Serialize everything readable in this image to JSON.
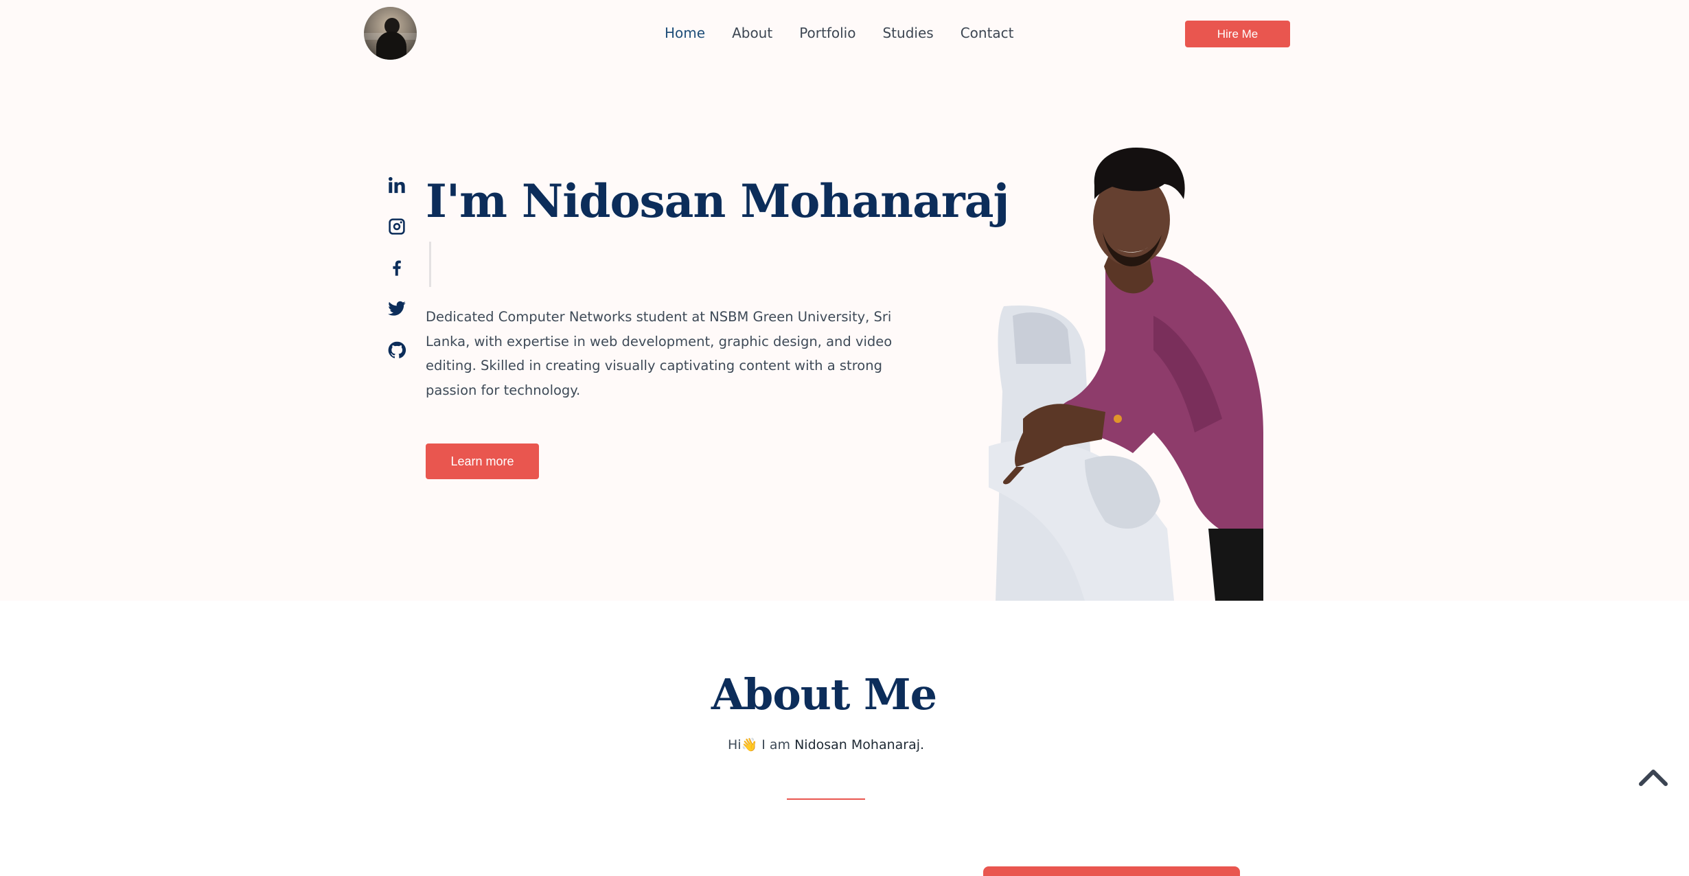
{
  "nav": {
    "items": [
      {
        "label": "Home",
        "active": true
      },
      {
        "label": "About"
      },
      {
        "label": "Portfolio"
      },
      {
        "label": "Studies"
      },
      {
        "label": "Contact"
      }
    ],
    "hire_label": "Hire Me"
  },
  "social": [
    "linkedin-icon",
    "instagram-icon",
    "facebook-icon",
    "twitter-icon",
    "github-icon"
  ],
  "hero": {
    "title": "I'm Nidosan Mohanaraj",
    "description": "Dedicated Computer Networks student at NSBM Green University, Sri Lanka, with expertise in web development, graphic design, and video editing. Skilled in creating visually captivating content with a strong passion for technology.",
    "cta_label": "Learn more"
  },
  "about": {
    "title": "About Me",
    "greeting": "Hi",
    "wave": "👋",
    "intro": " I am ",
    "name": "Nidosan Mohanaraj."
  },
  "colors": {
    "accent": "#e9564f",
    "navy": "#0c2d5a",
    "hero_bg": "#fffaf9"
  }
}
